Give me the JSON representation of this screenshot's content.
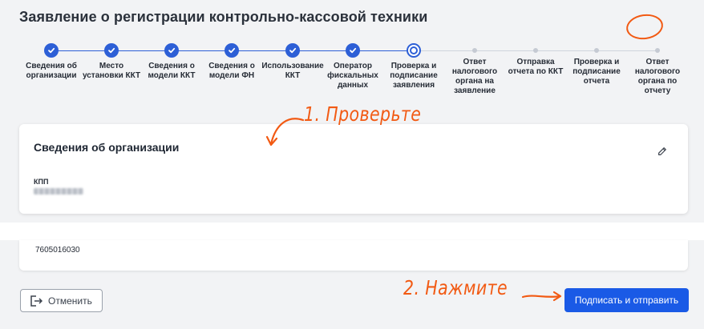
{
  "page": {
    "title": "Заявление о регистрации контрольно-кассовой техники"
  },
  "stepper": {
    "steps": [
      {
        "label": "Сведения об организации",
        "state": "done"
      },
      {
        "label": "Место установки ККТ",
        "state": "done"
      },
      {
        "label": "Сведения о модели ККТ",
        "state": "done"
      },
      {
        "label": "Сведения о модели ФН",
        "state": "done"
      },
      {
        "label": "Использование ККТ",
        "state": "done"
      },
      {
        "label": "Оператор фискальных данных",
        "state": "done"
      },
      {
        "label": "Проверка и подписание заявления",
        "state": "current"
      },
      {
        "label": "Ответ налогового органа на заявление",
        "state": "pending"
      },
      {
        "label": "Отправка отчета по ККТ",
        "state": "pending"
      },
      {
        "label": "Проверка и подписание отчета",
        "state": "pending"
      },
      {
        "label": "Ответ налогового органа по отчету",
        "state": "pending"
      }
    ],
    "active_color": "#2d5fd6"
  },
  "org_card": {
    "title": "Сведения об организации",
    "kpp_label": "КПП",
    "edit_icon": "pencil-icon"
  },
  "inn_card": {
    "value": "7605016030"
  },
  "actions": {
    "cancel_label": "Отменить",
    "cancel_icon": "exit-icon",
    "submit_label": "Подписать и отправить",
    "submit_color": "#1a5ae6"
  },
  "annotations": {
    "step1": "1. Проверьте",
    "step2": "2. Нажмите",
    "color": "#f25a13"
  }
}
